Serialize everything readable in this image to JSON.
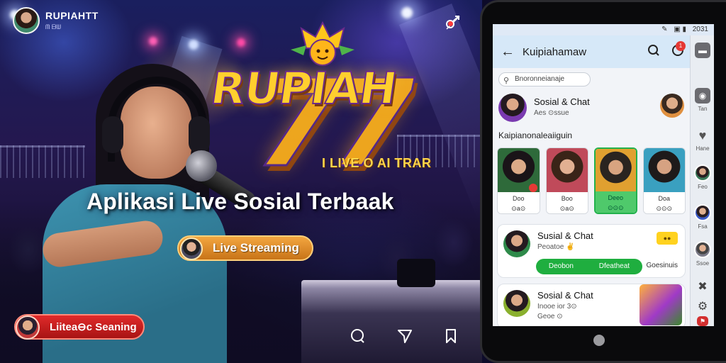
{
  "profile": {
    "name": "RUPIAHTT",
    "sub": "ᗰ ᗷᗯ"
  },
  "logo": {
    "line1": "RUPIAH",
    "line2": "77",
    "tagline": "I LIVE O AI TRAR"
  },
  "headline": "Aplikasi Live Sosial Terbaak",
  "live_pill": "Live Streaming",
  "scan_pill": "Liitea⊖c Seaning",
  "colors": {
    "gold": "#ffb21a",
    "live_pill": "#e8922c",
    "scan_pill": "#d42020",
    "app_green": "#1fae3f"
  },
  "icons": {
    "share": "share-off-icon",
    "comment": "comment-icon",
    "send": "send-icon",
    "bookmark": "bookmark-icon"
  },
  "phone": {
    "status": {
      "left": "✎",
      "icons": "▣ ▮",
      "time": "2031"
    },
    "app_title": "Kuipiahamaw",
    "search_placeholder": "Bnoronneianaje",
    "top_row": {
      "title": "Sosial & Chat",
      "sub": "Aes ⊙ssue"
    },
    "section_label": "Kaipianonaleaiiguin",
    "streams": [
      {
        "label": "Doo",
        "sub": "⊙a⊙"
      },
      {
        "label": "Boo",
        "sub": "⊙a⊙"
      },
      {
        "label": "Deeo",
        "sub": "⊙⊙⊙"
      },
      {
        "label": "Doa",
        "sub": "⊙⊙⊙"
      }
    ],
    "card1": {
      "title": "Susial & Chat",
      "sub": "Peoatoe ✌",
      "chip": "●●",
      "btn_left": "Deobon",
      "btn_right": "Dfeatheat",
      "link": "Goesinuis"
    },
    "card2": {
      "title": "Sosial & Chat",
      "sub": "Inooe ior 3⊙",
      "tag": "Geoe ⊙"
    },
    "sidebar": [
      {
        "icon": "card-icon",
        "label": ""
      },
      {
        "icon": "profile-icon",
        "label": "Tan"
      },
      {
        "icon": "heart-icon",
        "label": "Hane"
      },
      {
        "icon": "avatar",
        "label": "Feo"
      },
      {
        "icon": "avatar",
        "label": "Fsa"
      },
      {
        "icon": "avatar",
        "label": "Ssoe"
      },
      {
        "icon": "wrench-icon",
        "label": ""
      },
      {
        "icon": "settings-icon",
        "label": ""
      },
      {
        "icon": "flag-icon",
        "label": ""
      }
    ]
  }
}
